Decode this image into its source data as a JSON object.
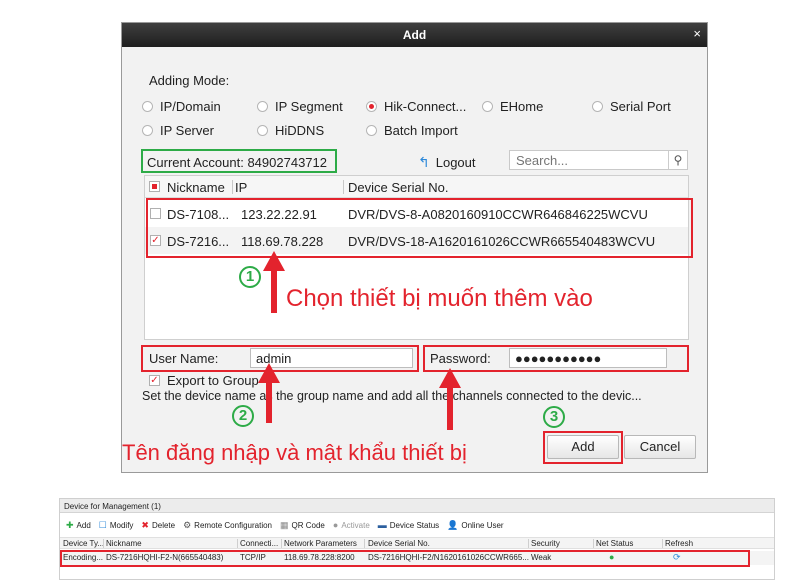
{
  "dialog": {
    "title": "Add",
    "close_icon": "close-icon",
    "adding_mode_label": "Adding Mode:",
    "modes": [
      {
        "label": "IP/Domain",
        "selected": false
      },
      {
        "label": "IP Segment",
        "selected": false
      },
      {
        "label": "Hik-Connect...",
        "selected": true
      },
      {
        "label": "EHome",
        "selected": false
      },
      {
        "label": "Serial Port",
        "selected": false
      },
      {
        "label": "IP Server",
        "selected": false
      },
      {
        "label": "HiDDNS",
        "selected": false
      },
      {
        "label": "Batch Import",
        "selected": false
      }
    ],
    "current_account_label": "Current Account:",
    "current_account_value": "84902743712",
    "logout_label": "Logout",
    "search_placeholder": "Search...",
    "columns": [
      "Nickname",
      "IP",
      "Device Serial No."
    ],
    "devices": [
      {
        "nickname": "DS-7108...",
        "ip": "123.22.22.91",
        "serial": "DVR/DVS-8-A0820160910CCWR646846225WCVU",
        "checked": false
      },
      {
        "nickname": "DS-7216...",
        "ip": "118.69.78.228",
        "serial": "DVR/DVS-18-A1620161026CCWR665540483WCVU",
        "checked": true
      }
    ],
    "annotation_1": "Chọn thiết bị muốn thêm vào",
    "user_name_label": "User Name:",
    "user_name_value": "admin",
    "password_label": "Password:",
    "password_value": "●●●●●●●●●●●",
    "export_label": "Export to Group",
    "export_checked": true,
    "set_note": "Set the device name as the group name and add all the channels connected to the devic...",
    "annotation_2": "Tên đăng nhập và mật khẩu thiết bị",
    "add_label": "Add",
    "cancel_label": "Cancel",
    "steps": [
      "1",
      "2",
      "3"
    ],
    "accent_red": "#e3232d",
    "accent_green": "#2dab47"
  },
  "management": {
    "title": "Device for Management (1)",
    "toolbar": [
      {
        "icon": "plus-icon",
        "label": "Add"
      },
      {
        "icon": "edit-icon",
        "label": "Modify"
      },
      {
        "icon": "delete-icon",
        "label": "Delete"
      },
      {
        "icon": "gear-icon",
        "label": "Remote Configuration"
      },
      {
        "icon": "qr-code-icon",
        "label": "QR Code"
      },
      {
        "icon": "activate-icon",
        "label": "Activate"
      },
      {
        "icon": "device-status-icon",
        "label": "Device Status"
      },
      {
        "icon": "user-icon",
        "label": "Online User"
      }
    ],
    "columns": [
      "Device Ty...",
      "Nickname",
      "Connecti...",
      "Network Parameters",
      "Device Serial No.",
      "Security",
      "Net Status",
      "Refresh"
    ],
    "row": {
      "type": "Encoding...",
      "nickname": "DS-7216HQHI-F2-N(665540483)",
      "connection": "TCP/IP",
      "network": "118.69.78.228:8200",
      "serial": "DS-7216HQHI-F2/N1620161026CCWR665...",
      "security": "Weak"
    }
  }
}
